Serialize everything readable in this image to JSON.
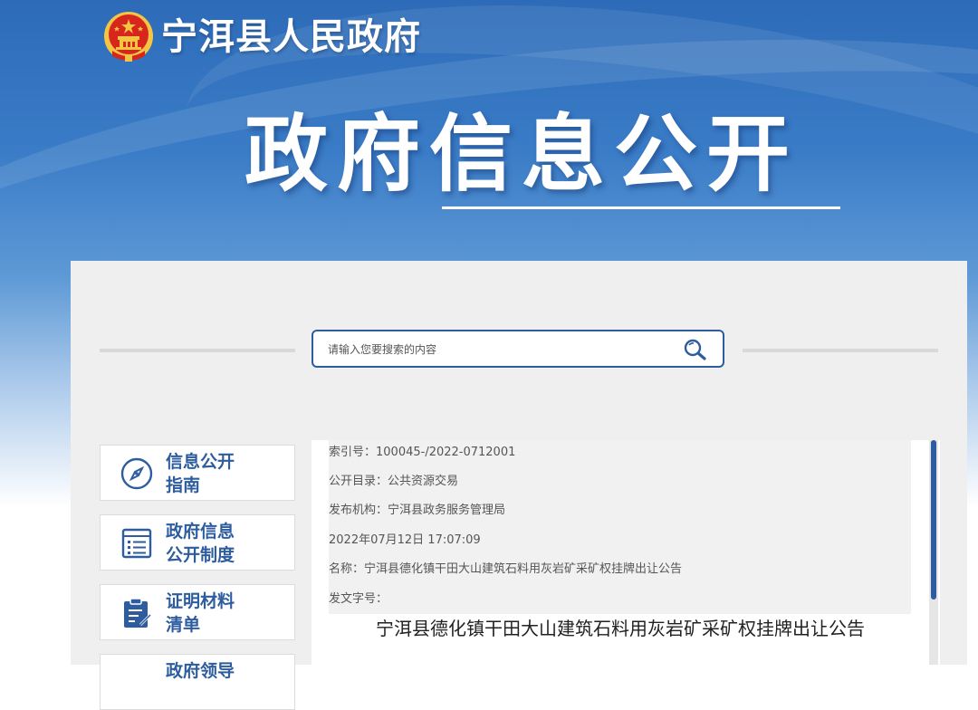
{
  "header": {
    "site_name": "宁洱县人民政府",
    "hero_title": "政府信息公开"
  },
  "search": {
    "placeholder": "请输入您要搜索的内容",
    "value": ""
  },
  "sidebar": {
    "items": [
      {
        "line1": "信息公开",
        "line2": "指南",
        "icon": "compass-icon"
      },
      {
        "line1": "政府信息",
        "line2": "公开制度",
        "icon": "document-list-icon"
      },
      {
        "line1": "证明材料",
        "line2": "清单",
        "icon": "clipboard-edit-icon"
      },
      {
        "line1": "政府领导",
        "line2": "",
        "icon": ""
      }
    ]
  },
  "document": {
    "meta": [
      "索引号：100045-/2022-0712001",
      "公开目录：公共资源交易",
      "发布机构：宁洱县政务服务管理局",
      "2022年07月12日 17:07:09",
      "名称：宁洱县德化镇干田大山建筑石料用灰岩矿采矿权挂牌出让公告",
      "发文字号："
    ],
    "title": "宁洱县德化镇干田大山建筑石料用灰岩矿采矿权挂牌出让公告"
  },
  "colors": {
    "brand_blue": "#2d5d9e",
    "emblem_red": "#d7261e",
    "emblem_gold": "#f4c542"
  }
}
